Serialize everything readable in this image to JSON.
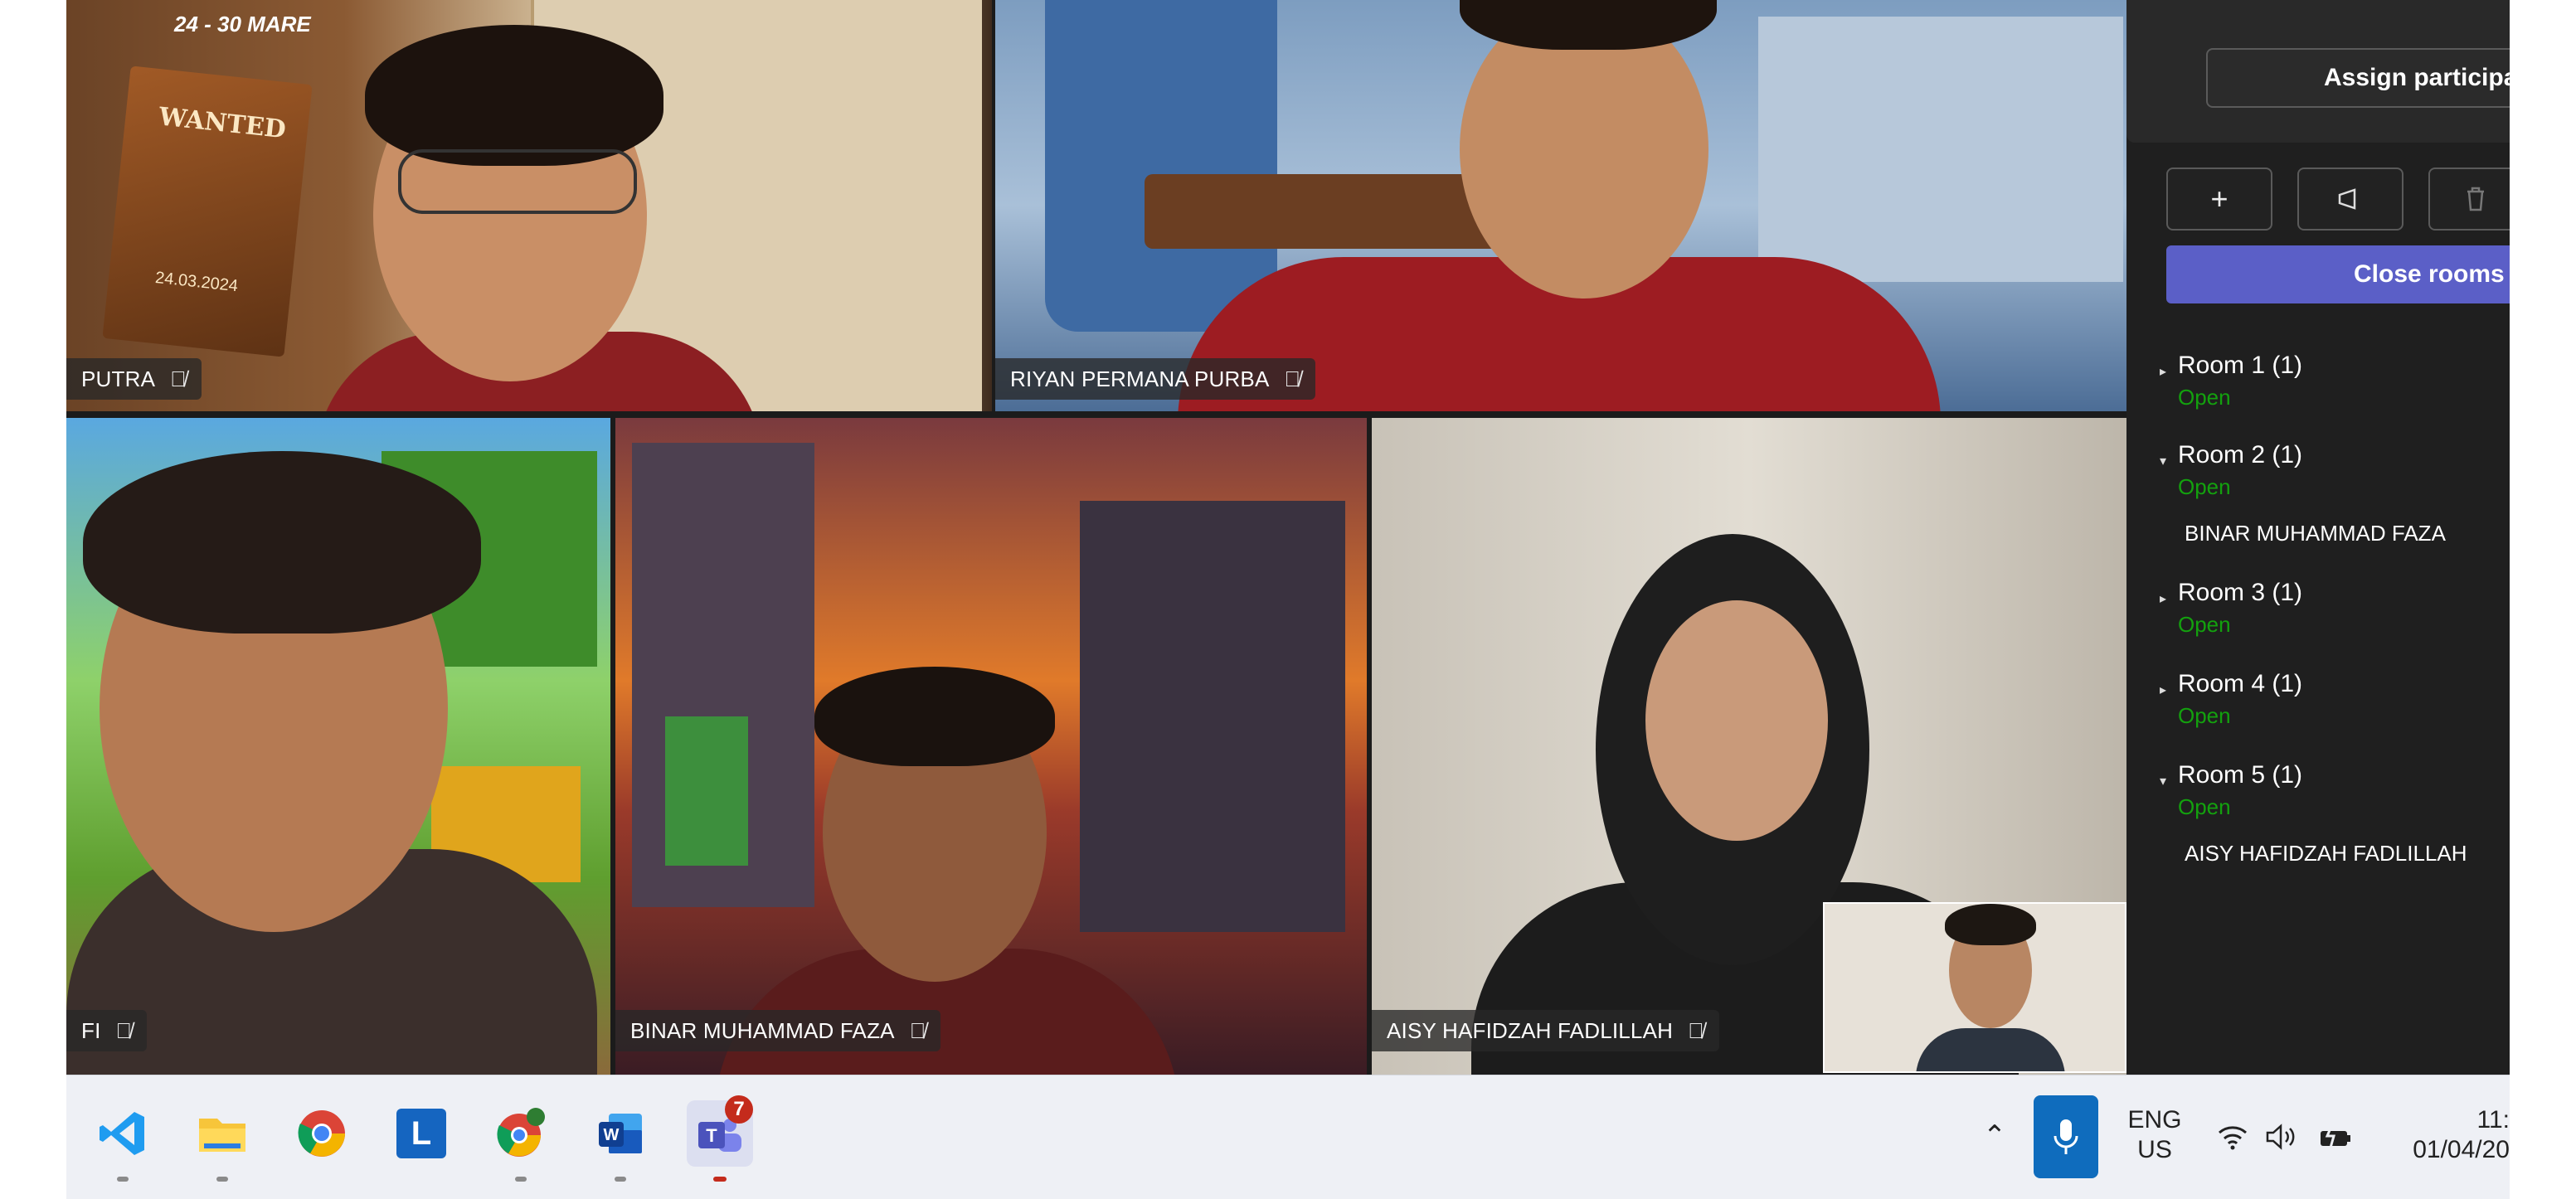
{
  "panel": {
    "assign_label": "Assign participan",
    "close_rooms_label": "Close rooms",
    "rooms": [
      {
        "title": "Room 1 (1)",
        "status": "Open",
        "member": ""
      },
      {
        "title": "Room 2 (1)",
        "status": "Open",
        "member": "BINAR MUHAMMAD FAZA"
      },
      {
        "title": "Room 3 (1)",
        "status": "Open",
        "member": ""
      },
      {
        "title": "Room 4 (1)",
        "status": "Open",
        "member": ""
      },
      {
        "title": "Room 5 (1)",
        "status": "Open",
        "member": "AISY HAFIDZAH FADLILLAH"
      }
    ],
    "icons": {
      "add": "plus-icon",
      "announce": "megaphone-icon",
      "delete": "trash-icon"
    }
  },
  "tiles": {
    "top_left_name": "PUTRA",
    "top_right_name": "RIYAN PERMANA PURBA",
    "bottom_left_name": "FI",
    "bottom_middle_name": "BINAR MUHAMMAD FAZA",
    "bottom_right_name": "AISY HAFIDZAH FADLILLAH",
    "poster_top": "24 - 30 MARE",
    "poster_wanted": "WANTED",
    "poster_date": "24.03.2024"
  },
  "taskbar": {
    "apps": [
      "vscode-icon",
      "file-explorer-icon",
      "chrome-icon",
      "l-app-icon",
      "chrome-profile-icon",
      "word-icon",
      "teams-icon"
    ],
    "teams_badge": "7",
    "lang_top": "ENG",
    "lang_bottom": "US",
    "time": "11:",
    "date": "01/04/20"
  },
  "colors": {
    "accent": "#5b5fc7",
    "open_status": "#13a10e",
    "panel_bg": "#1f1f1f",
    "badge": "#c42b1c"
  }
}
